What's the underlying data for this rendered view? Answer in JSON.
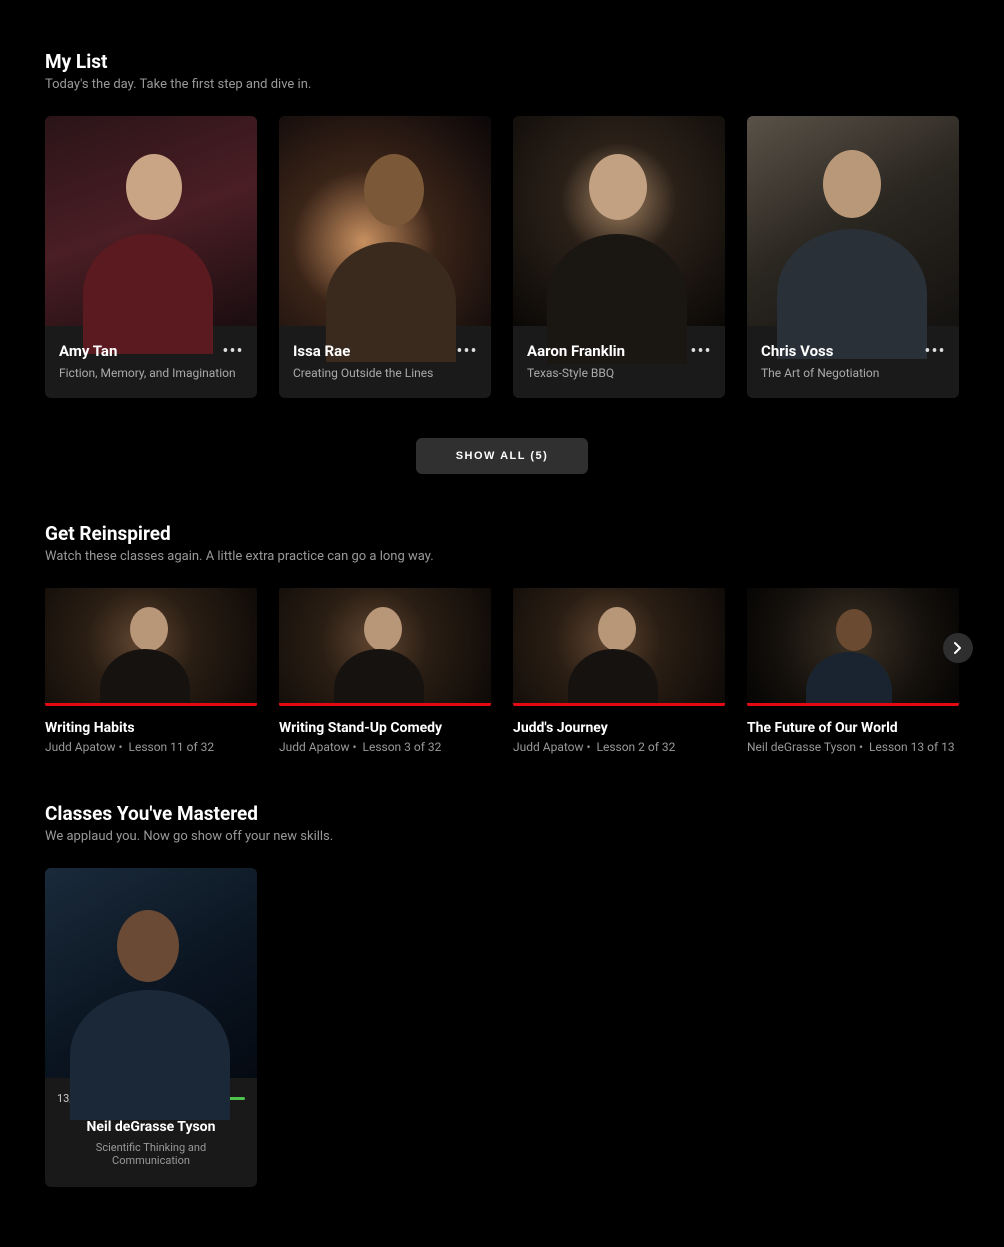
{
  "mylist": {
    "title": "My List",
    "subtitle": "Today's the day. Take the first step and dive in.",
    "items": [
      {
        "name": "Amy Tan",
        "desc": "Fiction, Memory, and Imagination"
      },
      {
        "name": "Issa Rae",
        "desc": "Creating Outside the Lines"
      },
      {
        "name": "Aaron Franklin",
        "desc": "Texas-Style BBQ"
      },
      {
        "name": "Chris Voss",
        "desc": "The Art of Negotiation"
      }
    ],
    "showAll": "SHOW ALL (5)"
  },
  "reinspired": {
    "title": "Get Reinspired",
    "subtitle": "Watch these classes again. A little extra practice can go a long way.",
    "items": [
      {
        "title": "Writing Habits",
        "instructor": "Judd Apatow",
        "lesson": "Lesson 11 of 32"
      },
      {
        "title": "Writing Stand-Up Comedy",
        "instructor": "Judd Apatow",
        "lesson": "Lesson 3 of 32"
      },
      {
        "title": "Judd's Journey",
        "instructor": "Judd Apatow",
        "lesson": "Lesson 2 of 32"
      },
      {
        "title": "The Future of Our World",
        "instructor": "Neil deGrasse Tyson",
        "lesson": "Lesson 13 of 13"
      }
    ]
  },
  "mastered": {
    "title": "Classes You've Mastered",
    "subtitle": "We applaud you. Now go show off your new skills.",
    "items": [
      {
        "count": "13/13",
        "name": "Neil deGrasse Tyson",
        "desc": "Scientific Thinking and Communication"
      }
    ]
  }
}
